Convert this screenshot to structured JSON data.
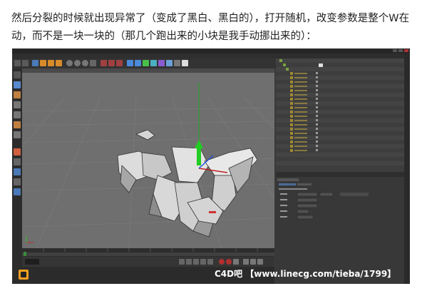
{
  "caption": {
    "line1": "然后分裂的时候就出现异常了（变成了黑白、黑白的），打开随机，改变参数是整个W在",
    "line2": "动，而不是一块一块的（那几个跑出来的小块是我手动挪出来的）："
  },
  "watermark": "C4D吧 【www.linecg.com/tieba/1799】",
  "colors": {
    "viewport": "#6f6f6f",
    "panel": "#3a3a3a",
    "accent": "#f0a020",
    "axis_y": "#22cc22",
    "axis_x": "#cc2222",
    "axis_z": "#2255ff"
  }
}
